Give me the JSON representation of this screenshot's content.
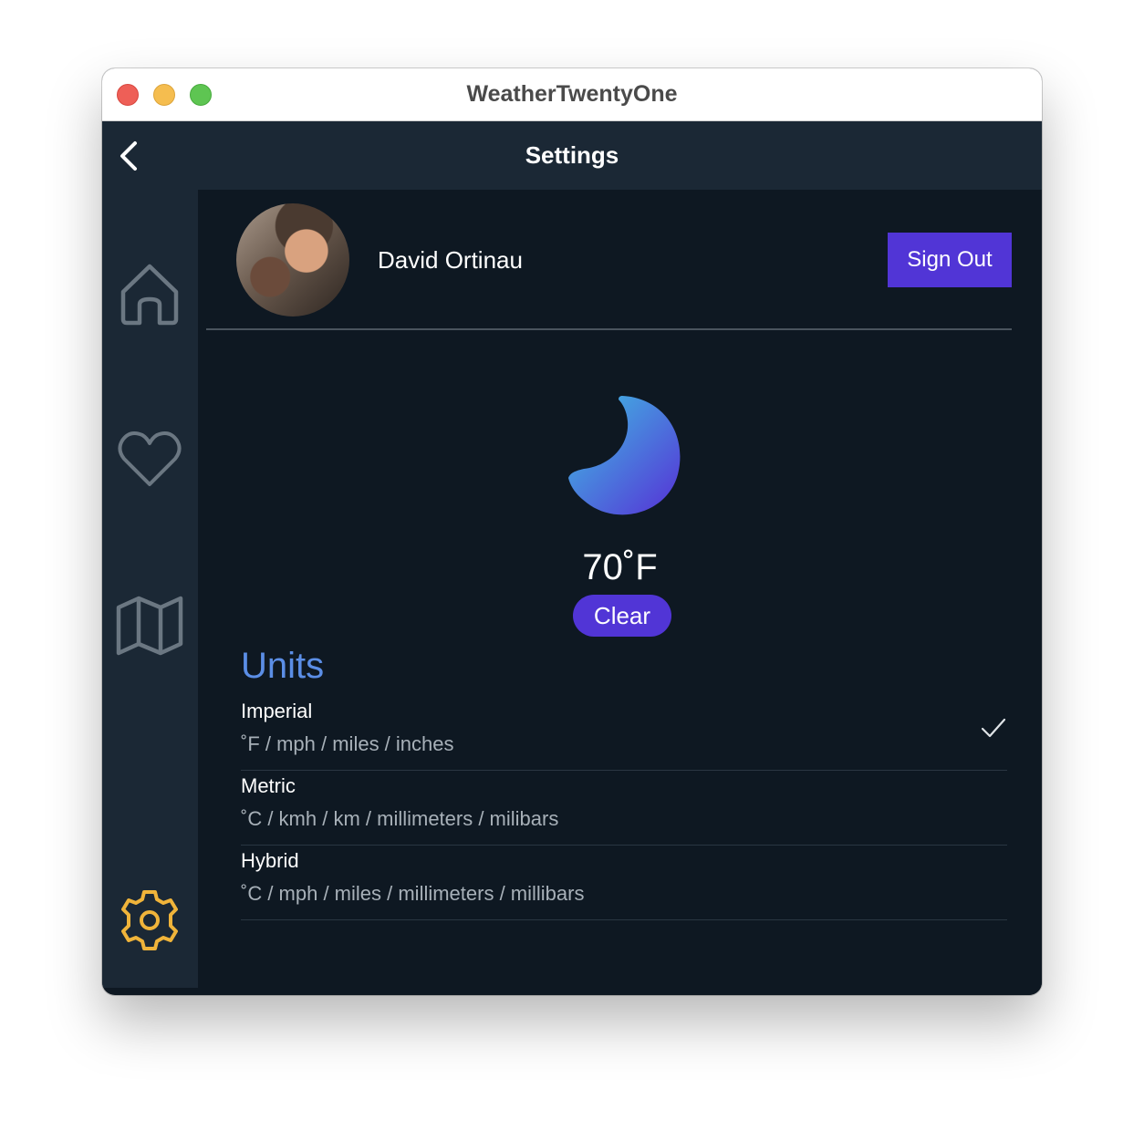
{
  "window": {
    "title": "WeatherTwentyOne"
  },
  "navbar": {
    "title": "Settings",
    "back_icon": "chevron-left-icon"
  },
  "sidebar": {
    "items": [
      {
        "name": "home",
        "icon": "home-icon"
      },
      {
        "name": "favorites",
        "icon": "heart-icon"
      },
      {
        "name": "map",
        "icon": "map-icon"
      },
      {
        "name": "settings",
        "icon": "gear-icon",
        "active": true
      }
    ],
    "colors": {
      "inactive": "#6b7782",
      "active": "#f0b43a"
    }
  },
  "profile": {
    "name": "David Ortinau",
    "signout_label": "Sign Out"
  },
  "current": {
    "temperature": "70˚F",
    "condition": "Clear",
    "icon": "moon-icon"
  },
  "units": {
    "heading": "Units",
    "options": [
      {
        "name": "Imperial",
        "description": "˚F / mph / miles / inches",
        "selected": true
      },
      {
        "name": "Metric",
        "description": "˚C / kmh / km / millimeters / milibars",
        "selected": false
      },
      {
        "name": "Hybrid",
        "description": "˚C / mph / miles / millimeters / millibars",
        "selected": false
      }
    ]
  },
  "colors": {
    "accent": "#5135d6",
    "heading": "#5b8ee6",
    "background": "#0e1822",
    "panel": "#1b2835"
  }
}
